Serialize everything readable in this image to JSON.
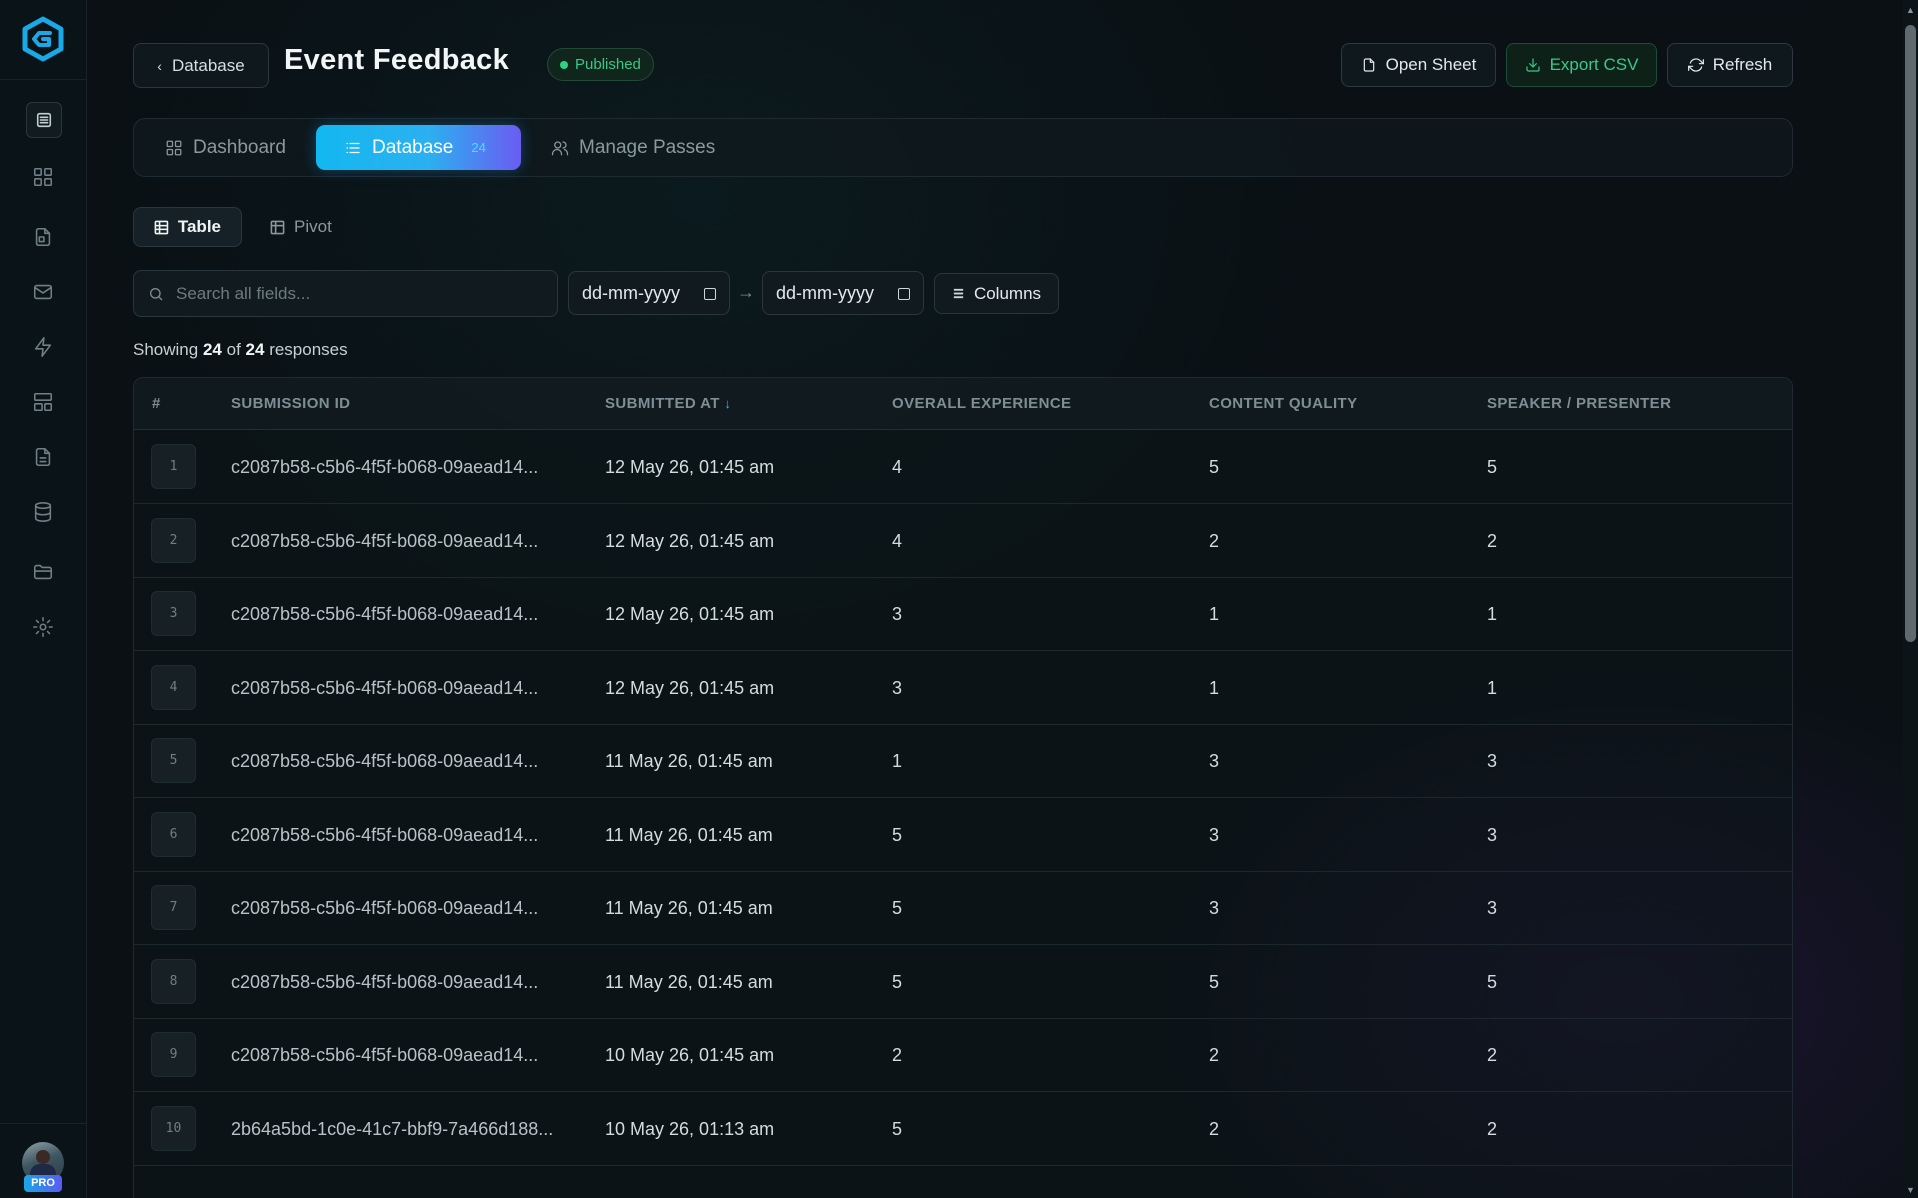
{
  "sidebar": {
    "icons": [
      "menu-icon",
      "dashboard-icon",
      "forms-icon",
      "mail-icon",
      "automation-icon",
      "templates-icon",
      "documents-icon",
      "database-icon",
      "folder-icon",
      "settings-icon"
    ],
    "pro_badge": "PRO"
  },
  "header": {
    "back_label": "Database",
    "title": "Event Feedback",
    "status": "Published",
    "open_sheet": "Open Sheet",
    "export_csv": "Export CSV",
    "refresh": "Refresh"
  },
  "tabs": [
    {
      "label": "Dashboard"
    },
    {
      "label": "Database",
      "count": "24"
    },
    {
      "label": "Manage Passes"
    }
  ],
  "views": {
    "table": "Table",
    "pivot": "Pivot"
  },
  "filters": {
    "search_placeholder": "Search all fields...",
    "date_from": "dd-mm-yyyy",
    "date_to": "dd-mm-yyyy",
    "arrow": "→",
    "columns": "Columns"
  },
  "summary": {
    "prefix": "Showing",
    "shown": "24",
    "of": "of",
    "total": "24",
    "suffix": "responses"
  },
  "table": {
    "headers": [
      "#",
      "SUBMISSION ID",
      "SUBMITTED AT",
      "OVERALL EXPERIENCE",
      "CONTENT QUALITY",
      "SPEAKER / PRESENTER"
    ],
    "sort_indicator": "↓",
    "rows": [
      {
        "n": "1",
        "id": "c2087b58-c5b6-4f5f-b068-09aead14...",
        "at": "12 May 26, 01:45 am",
        "oe": "4",
        "cq": "5",
        "sp": "5"
      },
      {
        "n": "2",
        "id": "c2087b58-c5b6-4f5f-b068-09aead14...",
        "at": "12 May 26, 01:45 am",
        "oe": "4",
        "cq": "2",
        "sp": "2"
      },
      {
        "n": "3",
        "id": "c2087b58-c5b6-4f5f-b068-09aead14...",
        "at": "12 May 26, 01:45 am",
        "oe": "3",
        "cq": "1",
        "sp": "1"
      },
      {
        "n": "4",
        "id": "c2087b58-c5b6-4f5f-b068-09aead14...",
        "at": "12 May 26, 01:45 am",
        "oe": "3",
        "cq": "1",
        "sp": "1"
      },
      {
        "n": "5",
        "id": "c2087b58-c5b6-4f5f-b068-09aead14...",
        "at": "11 May 26, 01:45 am",
        "oe": "1",
        "cq": "3",
        "sp": "3"
      },
      {
        "n": "6",
        "id": "c2087b58-c5b6-4f5f-b068-09aead14...",
        "at": "11 May 26, 01:45 am",
        "oe": "5",
        "cq": "3",
        "sp": "3"
      },
      {
        "n": "7",
        "id": "c2087b58-c5b6-4f5f-b068-09aead14...",
        "at": "11 May 26, 01:45 am",
        "oe": "5",
        "cq": "3",
        "sp": "3"
      },
      {
        "n": "8",
        "id": "c2087b58-c5b6-4f5f-b068-09aead14...",
        "at": "11 May 26, 01:45 am",
        "oe": "5",
        "cq": "5",
        "sp": "5"
      },
      {
        "n": "9",
        "id": "c2087b58-c5b6-4f5f-b068-09aead14...",
        "at": "10 May 26, 01:45 am",
        "oe": "2",
        "cq": "2",
        "sp": "2"
      },
      {
        "n": "10",
        "id": "2b64a5bd-1c0e-41c7-bbf9-7a466d188...",
        "at": "10 May 26, 01:13 am",
        "oe": "5",
        "cq": "2",
        "sp": "2"
      }
    ]
  },
  "colors": {
    "accent": "#13b8f0",
    "accent2": "#6b5cf2",
    "success": "#38c785"
  }
}
